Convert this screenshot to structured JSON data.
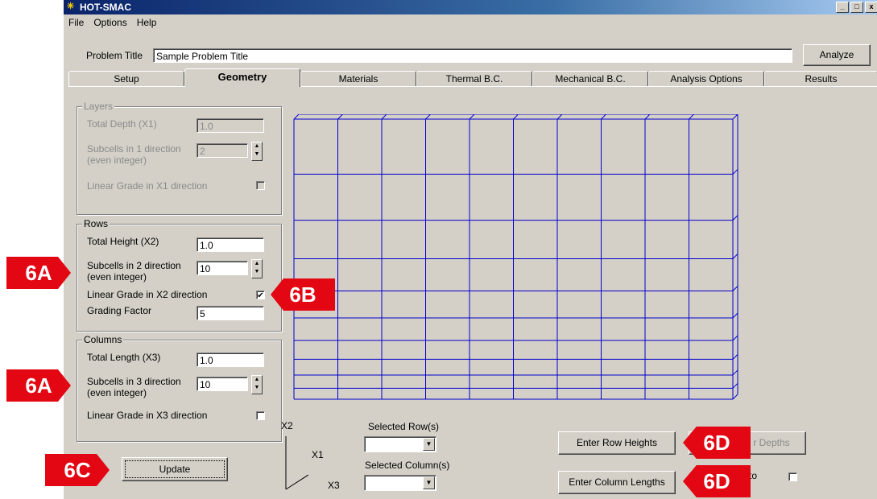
{
  "window": {
    "title": "HOT-SMAC",
    "controls": [
      "_",
      "□",
      "x"
    ]
  },
  "menu": [
    "File",
    "Options",
    "Help"
  ],
  "problem": {
    "label": "Problem Title",
    "value": "Sample Problem Title",
    "analyze": "Analyze"
  },
  "tabs": [
    "Setup",
    "Geometry",
    "Materials",
    "Thermal B.C.",
    "Mechanical B.C.",
    "Analysis Options",
    "Results"
  ],
  "active_tab": "Geometry",
  "layers": {
    "caption": "Layers",
    "depth_label": "Total Depth (X1)",
    "depth_value": "1.0",
    "sub_label1": "Subcells in 1 direction",
    "sub_label2": "(even integer)",
    "sub_value": "2",
    "grade_label": "Linear Grade in X1 direction",
    "grade_checked": false
  },
  "rows": {
    "caption": "Rows",
    "height_label": "Total Height (X2)",
    "height_value": "1.0",
    "sub_label1": "Subcells in 2 direction",
    "sub_label2": "(even integer)",
    "sub_value": "10",
    "grade_label": "Linear Grade in X2 direction",
    "grade_checked": "✔",
    "factor_label": "Grading Factor",
    "factor_value": "5"
  },
  "columns": {
    "caption": "Columns",
    "length_label": "Total Length (X3)",
    "length_value": "1.0",
    "sub_label1": "Subcells in 3 direction",
    "sub_label2": "(even integer)",
    "sub_value": "10",
    "grade_label": "Linear Grade in X3 direction",
    "grade_checked": false
  },
  "update": "Update",
  "axes": {
    "x2": "X2",
    "x1": "X1",
    "x3": "X3"
  },
  "selectors": {
    "row_label": "Selected Row(s)",
    "col_label": "Selected Column(s)"
  },
  "buttons": {
    "row_heights": "Enter Row Heights",
    "layer_depths_partial": "r Depths",
    "col_lengths": "Enter Column Lengths",
    "partial_to": "to"
  },
  "callouts": {
    "6A_top": "6A",
    "6A_bottom": "6A",
    "6B": "6B",
    "6C": "6C",
    "6D_top": "6D",
    "6D_bottom": "6D"
  },
  "colors": {
    "grid": "#0000cc",
    "callout": "#e30613",
    "face": "#d4d0c8"
  }
}
